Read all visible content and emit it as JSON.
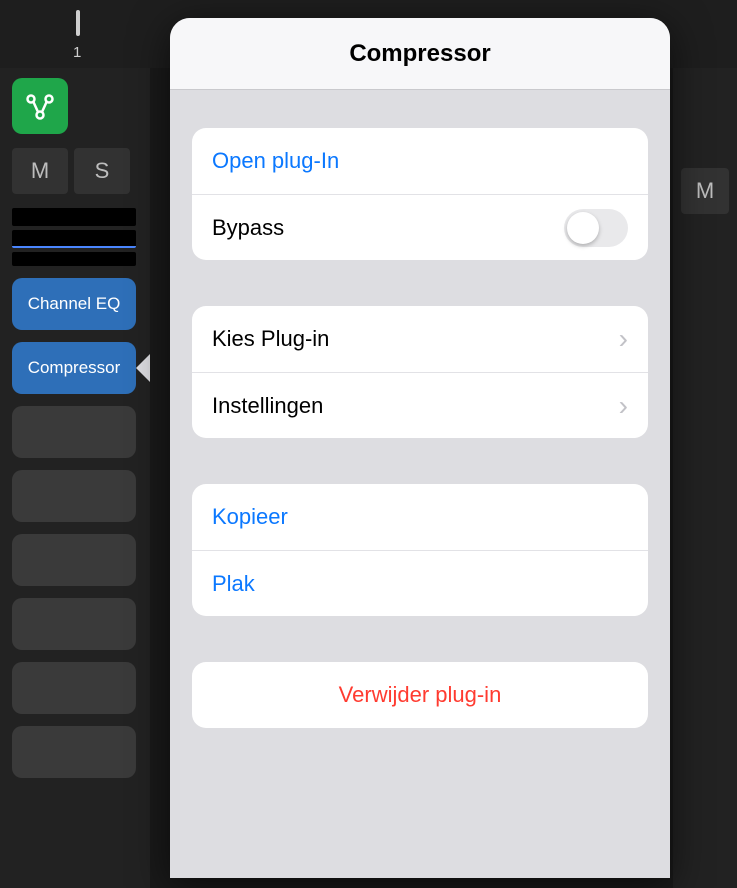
{
  "ruler": {
    "label_1": "1"
  },
  "sidebar": {
    "mute_label": "M",
    "solo_label": "S",
    "plugins": {
      "channel_eq": "Channel EQ",
      "compressor": "Compressor"
    }
  },
  "rightstrip": {
    "mute_label": "M"
  },
  "popover": {
    "title": "Compressor",
    "group1": {
      "open_plugin": "Open plug-In",
      "bypass_label": "Bypass",
      "bypass_on": false
    },
    "group2": {
      "choose_plugin": "Kies Plug-in",
      "settings": "Instellingen"
    },
    "group3": {
      "copy": "Kopieer",
      "paste": "Plak"
    },
    "group4": {
      "delete": "Verwijder plug-in"
    }
  }
}
